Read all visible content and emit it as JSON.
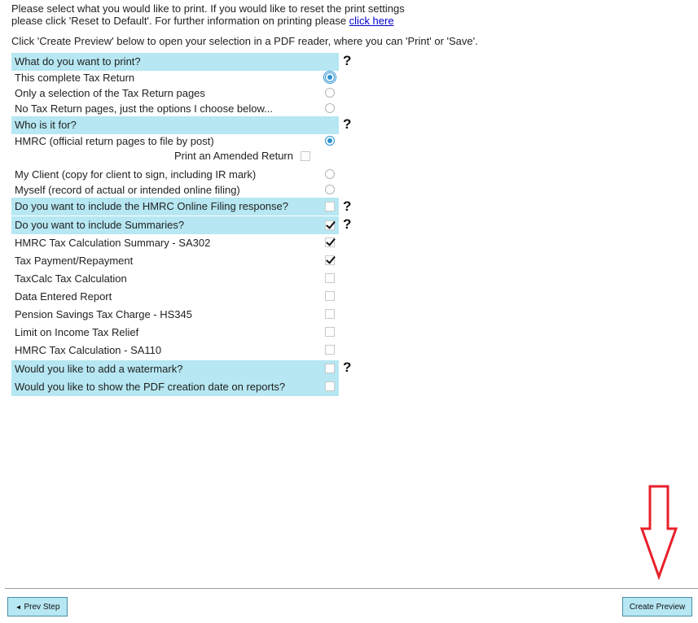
{
  "intro": {
    "line1": "Please select what you would like to print. If you would like to reset the print settings",
    "line2": "please click 'Reset to Default'. For further information on printing please ",
    "link": "click here",
    "line3": "Click 'Create Preview' below to open your selection in a PDF reader, where you can 'Print' or 'Save'."
  },
  "sections": {
    "what": "What do you want to print?",
    "what_options": [
      {
        "label": "This complete Tax Return",
        "selected": true
      },
      {
        "label": "Only a selection of the Tax Return pages",
        "selected": false
      },
      {
        "label": "No Tax Return pages, just the options I choose below...",
        "selected": false
      }
    ],
    "who": "Who is it for?",
    "who_options": [
      {
        "label": "HMRC (official return pages to file by post)",
        "selected": true
      },
      {
        "label": "My Client (copy for client to sign, including IR mark)",
        "selected": false
      },
      {
        "label": "Myself (record of actual or intended online filing)",
        "selected": false
      }
    ],
    "amended_label": "Print an Amended Return",
    "online_response": "Do you want to include the HMRC Online Filing response?",
    "summaries": "Do you want to include Summaries?",
    "summary_items": [
      {
        "label": "HMRC Tax Calculation Summary - SA302",
        "checked": true
      },
      {
        "label": "Tax Payment/Repayment",
        "checked": true
      },
      {
        "label": "TaxCalc Tax Calculation",
        "checked": false
      },
      {
        "label": "Data Entered Report",
        "checked": false
      },
      {
        "label": "Pension Savings Tax Charge - HS345",
        "checked": false
      },
      {
        "label": "Limit on Income Tax Relief",
        "checked": false
      },
      {
        "label": "HMRC Tax Calculation - SA110",
        "checked": false
      }
    ],
    "watermark": "Would you like to add a watermark?",
    "creation_date": "Would you like to show the PDF creation date on reports?"
  },
  "help_symbol": "?",
  "buttons": {
    "prev_icon": "◄",
    "prev": "Prev Step",
    "create": "Create Preview"
  },
  "colors": {
    "section_bg": "#b6e7f2",
    "radio_accent": "#2a8fce",
    "link": "#0000cc",
    "arrow": "#e8202a"
  },
  "icons": [
    "help-icon",
    "radio-icon",
    "checkbox-icon",
    "red-down-arrow-icon",
    "prev-triangle-icon"
  ]
}
